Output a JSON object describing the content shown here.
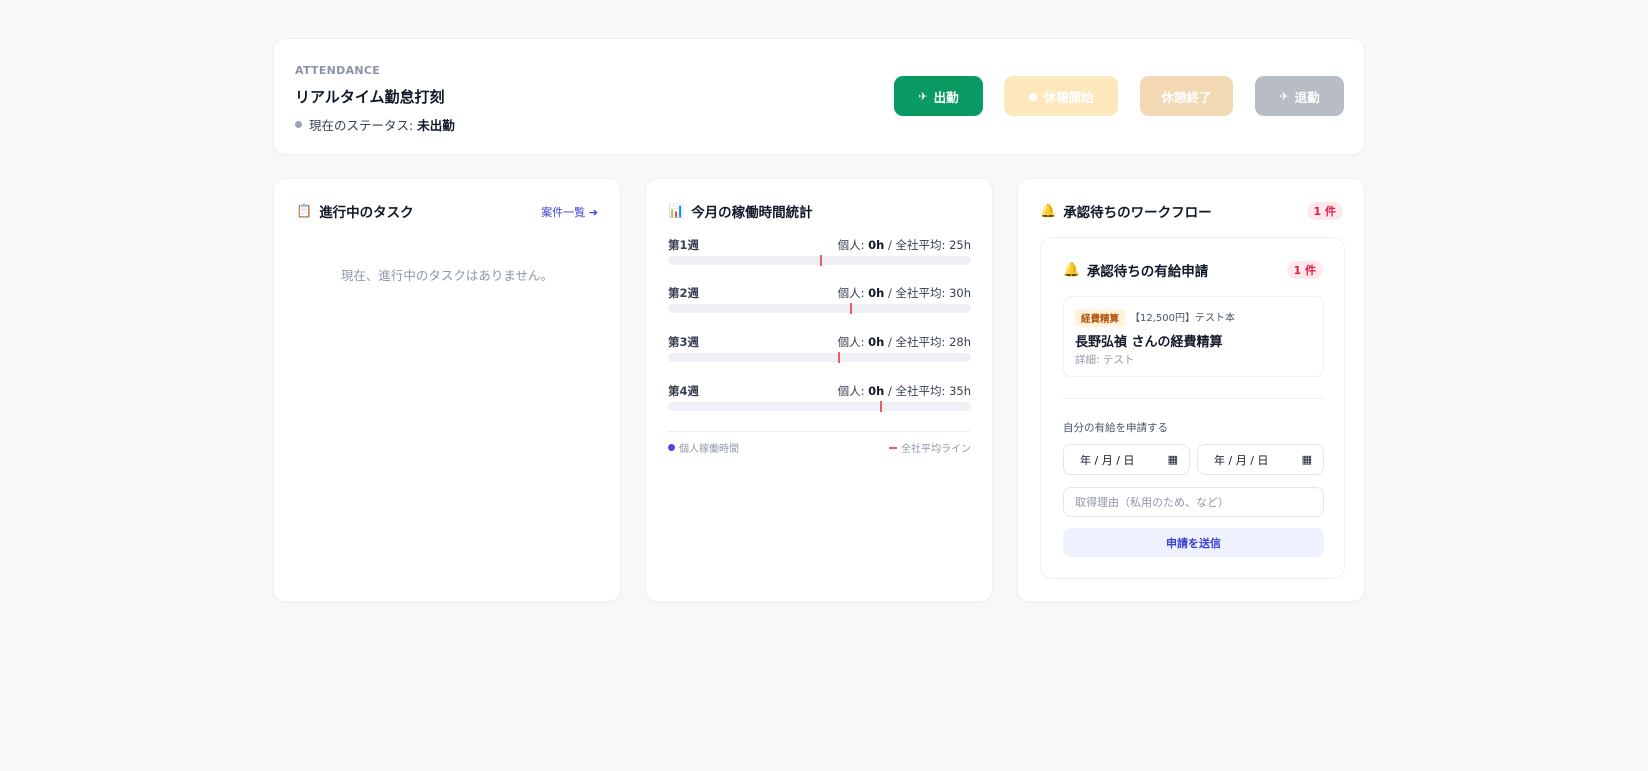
{
  "attendance": {
    "eyebrow": "ATTENDANCE",
    "title": "リアルタイム勤怠打刻",
    "status_prefix": "現在のステータス: ",
    "status_value": "未出勤",
    "buttons": {
      "clock_in": "出勤",
      "break_start": "休憩開始",
      "break_end": "休憩終了",
      "clock_out": "退勤"
    },
    "colors": {
      "clock_in": "#0a9a63",
      "break_start": "#fde7bd",
      "break_end": "#f2d9b4",
      "clock_out": "#b8bcc4"
    }
  },
  "tasks": {
    "icon": "clipboard-icon",
    "title": "進行中のタスク",
    "link": "案件一覧 ➔",
    "empty": "現在、進行中のタスクはありません。"
  },
  "stats": {
    "icon": "bar-chart-icon",
    "title": "今月の稼働時間統計",
    "weeks": [
      {
        "label": "第1週",
        "personal_prefix": "個人: ",
        "personal": "0h",
        "avg_text": " / 全社平均: 25h",
        "avg_hours": 25
      },
      {
        "label": "第2週",
        "personal_prefix": "個人: ",
        "personal": "0h",
        "avg_text": " / 全社平均: 30h",
        "avg_hours": 30
      },
      {
        "label": "第3週",
        "personal_prefix": "個人: ",
        "personal": "0h",
        "avg_text": " / 全社平均: 28h",
        "avg_hours": 28
      },
      {
        "label": "第4週",
        "personal_prefix": "個人: ",
        "personal": "0h",
        "avg_text": " / 全社平均: 35h",
        "avg_hours": 35
      }
    ],
    "scale_max_hours": 50,
    "legend_personal": "個人稼働時間",
    "legend_avg": "全社平均ライン"
  },
  "workflow": {
    "icon": "bell-icon",
    "title": "承認待ちのワークフロー",
    "count": "1 件",
    "leave": {
      "icon": "bell-icon",
      "title": "承認待ちの有給申請",
      "count": "1 件",
      "request": {
        "tag": "経費精算",
        "amount": "【12,500円】テスト本",
        "name": "長野弘禎 さんの経費精算",
        "detail": "詳細: テスト"
      },
      "form_label": "自分の有給を申請する",
      "date_from": "年 / 月 / 日",
      "date_to": "年 / 月 / 日",
      "reason_placeholder": "取得理由（私用のため、など）",
      "submit": "申請を送信"
    }
  }
}
